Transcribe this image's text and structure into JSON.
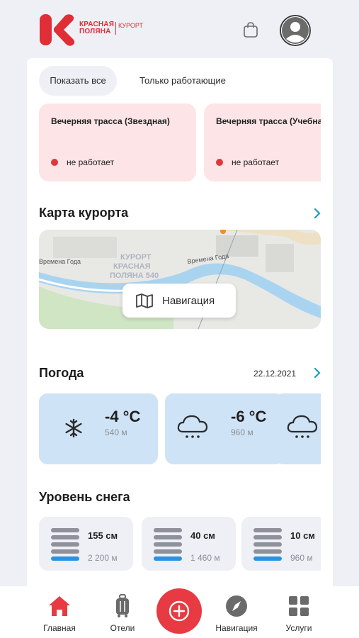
{
  "brand": {
    "name_line1": "КРАСНАЯ",
    "name_line2": "ПОЛЯНА",
    "suffix": "КУРОРТ",
    "color": "#e02e36"
  },
  "header": {
    "cart_icon": "shopping-bag-icon",
    "profile_icon": "user-avatar-icon"
  },
  "filters": {
    "show_all": "Показать все",
    "only_working": "Только работающие"
  },
  "trails": [
    {
      "name": "Вечерняя трасса (Звездная)",
      "status": "не работает"
    },
    {
      "name": "Вечерняя трасса (Учебная)",
      "status": "не работает"
    }
  ],
  "map_section": {
    "title": "Карта курорта",
    "map_labels": [
      "КУРОРТ",
      "КРАСНАЯ",
      "ПОЛЯНА 540",
      "Времена Года",
      "Времена Года"
    ],
    "nav_button": "Навигация"
  },
  "weather": {
    "title": "Погода",
    "date": "22.12.2021",
    "items": [
      {
        "icon": "snowflake-icon",
        "temp": "-4 °C",
        "alt": "540 м"
      },
      {
        "icon": "snow-cloud-icon",
        "temp": "-6 °C",
        "alt": "960 м"
      },
      {
        "icon": "snow-cloud-icon",
        "temp": "",
        "alt": ""
      }
    ]
  },
  "snow": {
    "title": "Уровень снега",
    "items": [
      {
        "value": "155 см",
        "alt": "2 200 м"
      },
      {
        "value": "40 см",
        "alt": "1 460 м"
      },
      {
        "value": "10 см",
        "alt": "960 м"
      }
    ]
  },
  "tabbar": {
    "home": "Главная",
    "hotels": "Отели",
    "navigation": "Навигация",
    "services": "Услуги"
  },
  "colors": {
    "accent": "#e73a42",
    "trail_card_bg": "#fde4e6",
    "weather_card_bg": "#cfe3f6",
    "chevron": "#1f9bbf"
  }
}
